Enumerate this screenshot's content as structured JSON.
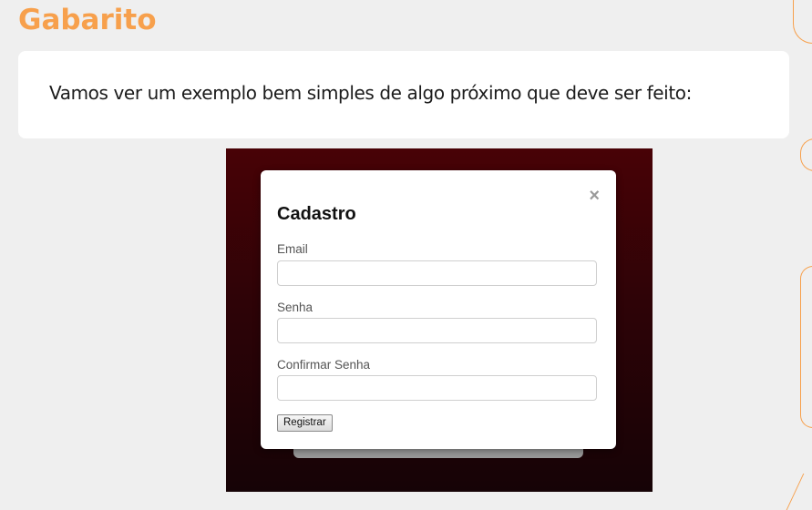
{
  "slide": {
    "title": "Gabarito",
    "intro_text": "Vamos ver um exemplo bem simples de algo próximo que deve ser feito:"
  },
  "example_modal": {
    "close_symbol": "×",
    "title": "Cadastro",
    "fields": [
      {
        "label": "Email",
        "value": ""
      },
      {
        "label": "Senha",
        "value": ""
      },
      {
        "label": "Confirmar Senha",
        "value": ""
      }
    ],
    "submit_label": "Registrar"
  },
  "colors": {
    "accent": "#f7a04c",
    "background": "#efefef",
    "frame_top": "#480206",
    "frame_bottom": "#160306"
  }
}
